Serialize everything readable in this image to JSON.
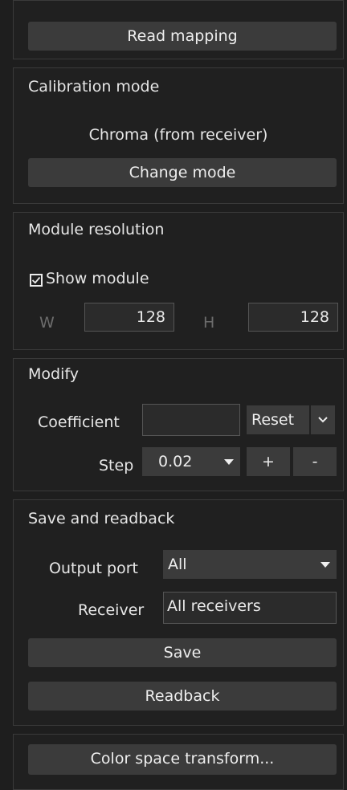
{
  "read_mapping_label": "Read mapping",
  "calibration": {
    "title": "Calibration mode",
    "value": "Chroma (from receiver)",
    "change_label": "Change mode"
  },
  "module_resolution": {
    "title": "Module resolution",
    "show_module_label": "Show module",
    "show_module_checked": true,
    "w_label": "W",
    "w_value": "128",
    "h_label": "H",
    "h_value": "128"
  },
  "modify": {
    "title": "Modify",
    "coefficient_label": "Coefficient",
    "coefficient_value": "",
    "reset_label": "Reset",
    "step_label": "Step",
    "step_value": "0.02",
    "plus_label": "+",
    "minus_label": "-"
  },
  "save_readback": {
    "title": "Save and readback",
    "output_port_label": "Output port",
    "output_port_value": "All",
    "receiver_label": "Receiver",
    "receiver_value": "All receivers",
    "save_label": "Save",
    "readback_label": "Readback"
  },
  "color_space_label": "Color space transform...",
  "colors": {
    "background": "#1e1e1e",
    "button": "#3b3b3b",
    "field": "#2b2b2b",
    "text": "#eaeaea"
  }
}
